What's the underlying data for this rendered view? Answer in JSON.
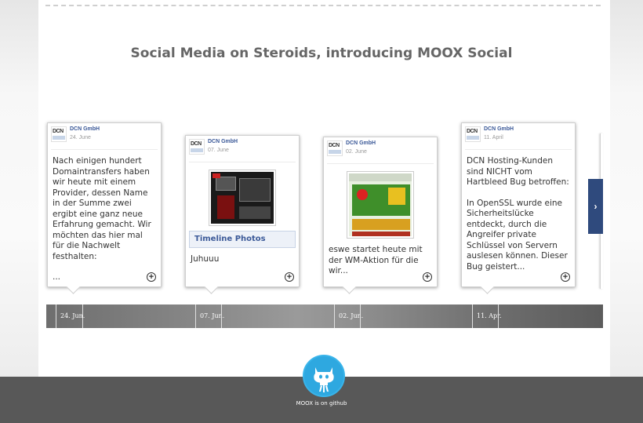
{
  "title": "Social Media on Steroids, introducing MOOX Social",
  "posts": [
    {
      "author": "DCN GmbH",
      "date": "24. June",
      "text": "Nach einigen hundert Domaintransfers haben wir heute mit einem Provider, dessen Name in der Summe zwei ergibt eine ganz neue Erfahrung gemacht. Wir möchten das hier mal für die Nachwelt festhalten:",
      "more": "..."
    },
    {
      "author": "DCN GmbH",
      "date": "07. June",
      "photos_label": "Timeline Photos",
      "text": "Juhuuu"
    },
    {
      "author": "DCN GmbH",
      "date": "02. June",
      "text": "eswe startet heute mit der WM-Aktion für die wir..."
    },
    {
      "author": "DCN GmbH",
      "date": "11. April",
      "text": "DCN Hosting-Kunden sind NICHT vom Hartbleed Bug betroffen:",
      "text2": "In OpenSSL wurde eine Sicherheitslücke entdeckt, durch die Angreifer private Schlüssel von Servern auslesen können. Dieser Bug geistert..."
    }
  ],
  "logo_text": "DCN",
  "timeline": [
    "24. Jun.",
    "07. Jun.",
    "02. Jun.",
    "11. Apr."
  ],
  "next_arrow": "›",
  "plus_glyph": "+",
  "footer": {
    "github_label": "MOOX is on github",
    "icon": "github-octocat-icon"
  },
  "colors": {
    "link": "#3b5998",
    "nav": "#2f4a7d",
    "github": "#2ea8e0",
    "footer": "#585858"
  }
}
